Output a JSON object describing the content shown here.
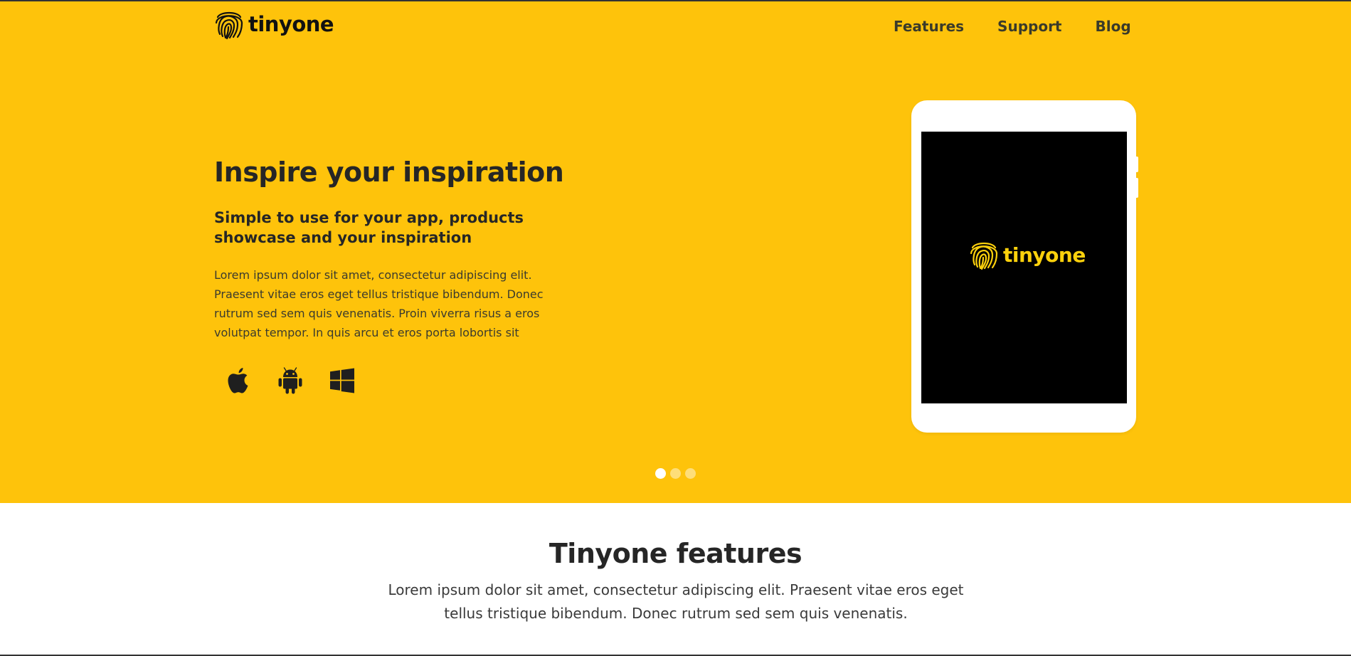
{
  "brand": {
    "name": "tinyone",
    "accent_color": "#fec30b",
    "logo_icon": "fingerprint-icon"
  },
  "nav": {
    "items": [
      {
        "label": "Features"
      },
      {
        "label": "Support"
      },
      {
        "label": "Blog"
      }
    ]
  },
  "hero": {
    "headline": "Inspire your inspiration",
    "subhead": "Simple to use for your app, products showcase and your inspiration",
    "body": "Lorem ipsum dolor sit amet, consectetur adipiscing elit. Praesent vitae eros eget tellus tristique bibendum. Donec rutrum sed sem quis venenatis. Proin viverra risus a eros volutpat tempor. In quis arcu et eros porta lobortis sit",
    "platforms": [
      "apple-icon",
      "android-icon",
      "windows-icon"
    ],
    "device_screen_brand": "tinyone",
    "carousel": {
      "count": 3,
      "active": 0
    }
  },
  "features": {
    "title": "Tinyone features",
    "text": "Lorem ipsum dolor sit amet, consectetur adipiscing elit. Praesent vitae eros eget tellus tristique bibendum. Donec rutrum sed sem quis venenatis."
  }
}
